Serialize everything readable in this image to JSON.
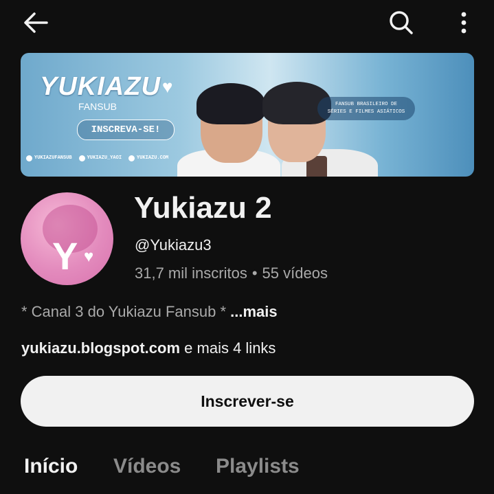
{
  "topbar": {
    "back_icon": "arrow-left-icon",
    "search_icon": "search-icon",
    "more_icon": "more-vertical-icon"
  },
  "banner": {
    "title": "YUKIAZU",
    "heart": "♥",
    "subtitle": "FANSUB",
    "cta": "INSCREVA-SE!",
    "tagline_line1": "FANSUB BRASILEIRO DE",
    "tagline_line2": "SÉRIES E FILMES ASIÁTICOS",
    "socials": [
      "YUKIAZUFANSUB",
      "YUKIAZU_YAOI",
      "YUKIAZU.COM"
    ]
  },
  "channel": {
    "avatar_letter": "Y",
    "avatar_heart": "♥",
    "name": "Yukiazu 2",
    "handle": "@Yukiazu3",
    "subscribers": "31,7 mil inscritos",
    "separator": "•",
    "videos": "55 vídeos",
    "description": "* Canal 3 do Yukiazu Fansub *",
    "description_more": "...mais",
    "link_main": "yukiazu.blogspot.com",
    "link_more": "e mais 4 links",
    "subscribe_label": "Inscrever-se"
  },
  "tabs": [
    {
      "label": "Início",
      "active": true
    },
    {
      "label": "Vídeos",
      "active": false
    },
    {
      "label": "Playlists",
      "active": false
    }
  ],
  "colors": {
    "background": "#0f0f0f",
    "primary_text": "#f1f1f1",
    "secondary_text": "#aaaaaa",
    "subscribe_bg": "#f1f1f1",
    "avatar_pink": "#e38bbd"
  }
}
